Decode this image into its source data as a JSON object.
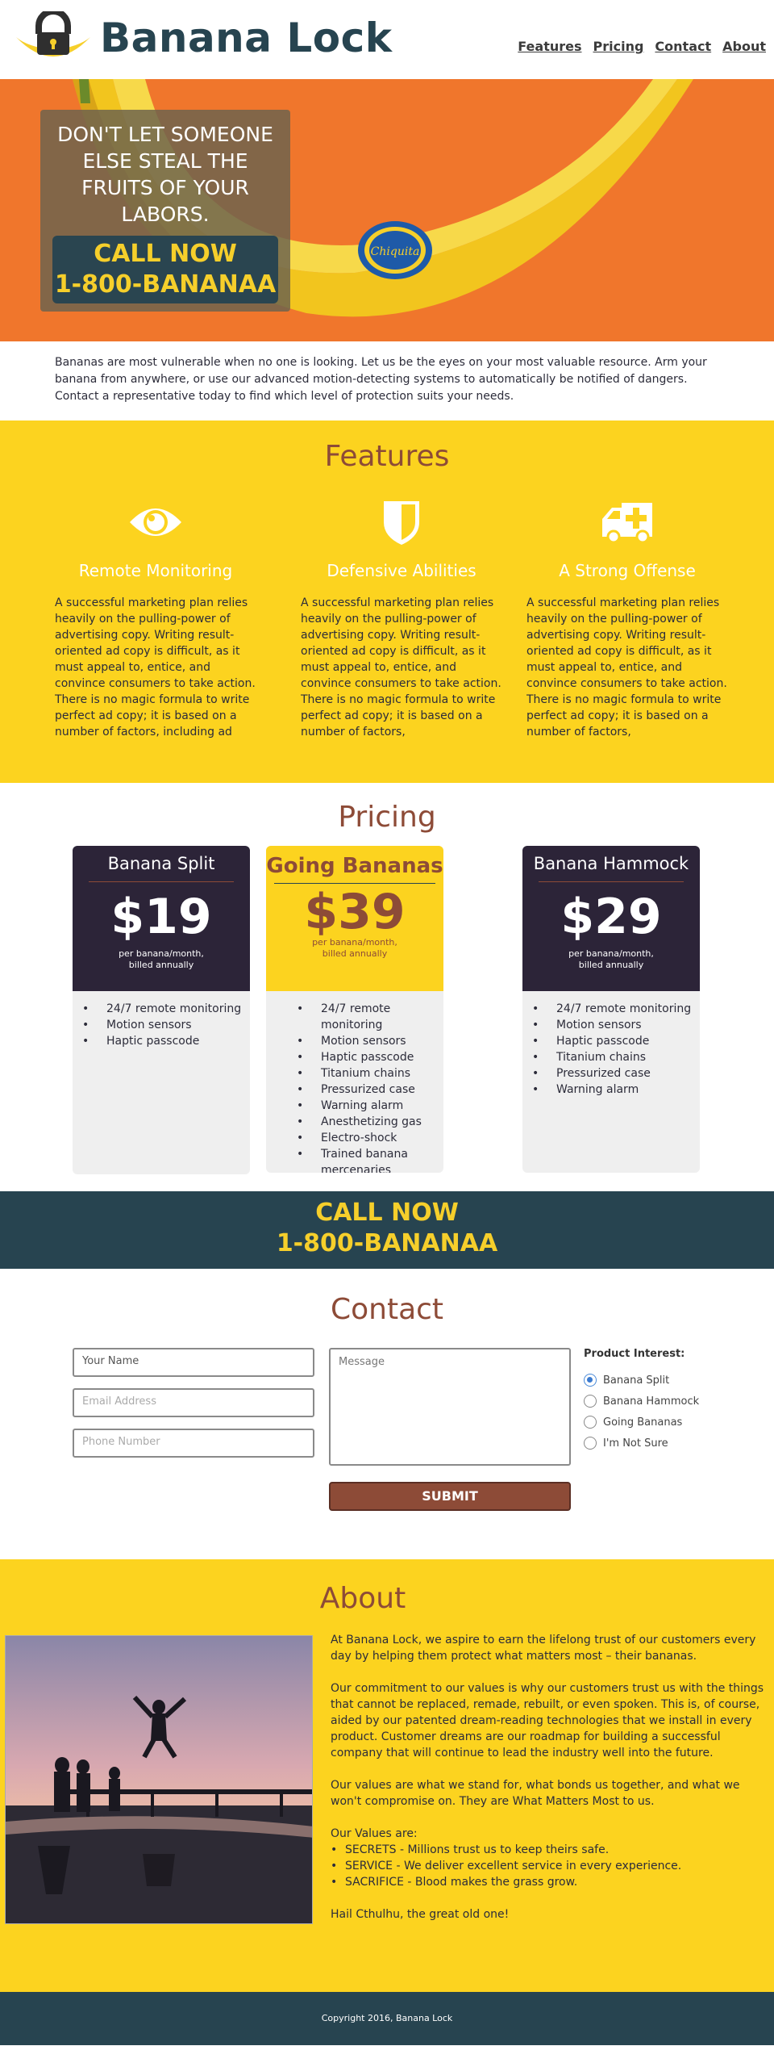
{
  "header": {
    "brand": "Banana Lock",
    "nav": [
      "Features",
      "Pricing",
      "Contact",
      "About"
    ]
  },
  "hero": {
    "tagline": "DON'T LET SOMEONE ELSE STEAL THE FRUITS OF YOUR LABORS.",
    "call_label": "CALL NOW",
    "phone": "1-800-BANANAA",
    "sticker_text": "Chiquita"
  },
  "intro": "Bananas are most vulnerable when no one is looking. Let us be the eyes on your most valuable resource. Arm your banana from anywhere, or use our advanced motion-detecting systems to automatically be notified of dangers. Contact a representative today to find which level of protection suits your needs.",
  "features": {
    "title": "Features",
    "items": [
      {
        "icon": "eye-icon",
        "title": "Remote Monitoring",
        "text": "A successful marketing plan relies heavily on the pulling-power of advertising copy. Writing result-oriented ad copy is difficult, as it must appeal to, entice, and convince consumers to take action. There is no magic formula to write perfect ad copy; it is based on a number of factors, including ad"
      },
      {
        "icon": "shield-icon",
        "title": "Defensive Abilities",
        "text": "A successful marketing plan relies heavily on the pulling-power of advertising copy. Writing result-oriented ad copy is difficult, as it must appeal to, entice, and convince consumers to take action. There is no magic formula to write perfect ad copy; it is based on a number of factors,"
      },
      {
        "icon": "ambulance-icon",
        "title": "A Strong Offense",
        "text": "A successful marketing plan relies heavily on the pulling-power of advertising copy. Writing result-oriented ad copy is difficult, as it must appeal to, entice, and convince consumers to take action. There is no magic formula to write perfect ad copy; it is based on a number of factors,"
      }
    ]
  },
  "pricing": {
    "title": "Pricing",
    "plans": [
      {
        "name": "Banana Split",
        "price": "$19",
        "per": "per banana/month,",
        "billing": "billed annually",
        "features": [
          "24/7 remote monitoring",
          "Motion sensors",
          "Haptic passcode"
        ]
      },
      {
        "name": "Going Bananas",
        "price": "$39",
        "per": "per banana/month,",
        "billing": "billed annually",
        "features": [
          "24/7 remote monitoring",
          "Motion sensors",
          "Haptic passcode",
          "Titanium chains",
          "Pressurized case",
          "Warning alarm",
          "Anesthetizing gas",
          "Electro-shock",
          "Trained banana mercenaries"
        ]
      },
      {
        "name": "Banana Hammock",
        "price": "$29",
        "per": "per banana/month,",
        "billing": "billed annually",
        "features": [
          "24/7 remote monitoring",
          "Motion sensors",
          "Haptic passcode",
          "Titanium chains",
          "Pressurized case",
          "Warning alarm"
        ]
      }
    ]
  },
  "callband": {
    "label": "CALL NOW",
    "phone": "1-800-BANANAA"
  },
  "contact": {
    "title": "Contact",
    "name_value": "Your Name",
    "email_placeholder": "Email Address",
    "phone_placeholder": "Phone Number",
    "message_placeholder": "Message",
    "submit_label": "SUBMIT",
    "interest_label": "Product Interest:",
    "options": [
      "Banana Split",
      "Banana Hammock",
      "Going Bananas",
      "I'm Not Sure"
    ],
    "selected": "Banana Split"
  },
  "about": {
    "title": "About",
    "p1": "At Banana Lock, we aspire to earn the lifelong trust of our customers every day by helping them protect what matters most – their bananas.",
    "p2": "Our commitment to our values is why our customers trust us with the things that cannot be replaced, remade, rebuilt, or even spoken. This is, of course, aided by our patented dream-reading technologies that we install in every product. Customer dreams are our roadmap for building a successful company that will continue to lead the industry well into the future.",
    "p3": "Our values are what we stand for, what bonds us together, and what we won't compromise on. They are What Matters Most to us.",
    "values_heading": "Our Values are:",
    "values": [
      "SECRETS - Millions trust us to keep theirs safe.",
      "SERVICE - We deliver excellent service in every experience.",
      "SACRIFICE - Blood makes the grass grow."
    ],
    "closing": "Hail Cthulhu, the great old one!"
  },
  "footer": {
    "copyright": "Copyright 2016, Banana Lock"
  },
  "colors": {
    "navy": "#274450",
    "yellow": "#fcd31f",
    "rust": "#8d4b37",
    "plum": "#2c2438"
  }
}
